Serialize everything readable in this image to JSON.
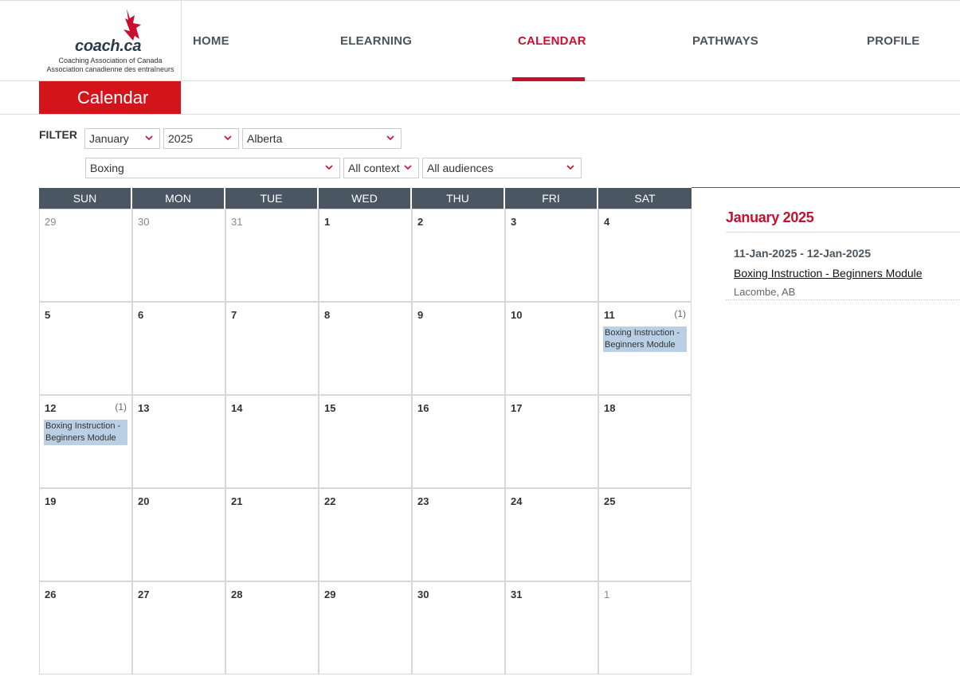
{
  "brand": {
    "logo_word": "coach.ca",
    "line1": "Coaching Association of Canada",
    "line2": "Association canadienne des entraîneurs",
    "accent": "#c8102e"
  },
  "nav": {
    "items": [
      {
        "label": "HOME"
      },
      {
        "label": "ELEARNING"
      },
      {
        "label": "CALENDAR",
        "active": true
      },
      {
        "label": "PATHWAYS"
      },
      {
        "label": "PROFILE"
      }
    ]
  },
  "page": {
    "title": "Calendar"
  },
  "filter": {
    "label": "FILTER",
    "month": "January",
    "year": "2025",
    "province": "Alberta",
    "sport": "Boxing",
    "context": "All context",
    "audience": "All audiences"
  },
  "calendar": {
    "weekdays": [
      "SUN",
      "MON",
      "TUE",
      "WED",
      "THU",
      "FRI",
      "SAT"
    ],
    "weeks": [
      [
        {
          "d": "29",
          "m": true
        },
        {
          "d": "30",
          "m": true
        },
        {
          "d": "31",
          "m": true
        },
        {
          "d": "1"
        },
        {
          "d": "2"
        },
        {
          "d": "3"
        },
        {
          "d": "4"
        }
      ],
      [
        {
          "d": "5"
        },
        {
          "d": "6"
        },
        {
          "d": "7"
        },
        {
          "d": "8"
        },
        {
          "d": "9"
        },
        {
          "d": "10"
        },
        {
          "d": "11",
          "count": "(1)",
          "event": "Boxing Instruction - Beginners Module"
        }
      ],
      [
        {
          "d": "12",
          "count": "(1)",
          "event": "Boxing Instruction - Beginners Module"
        },
        {
          "d": "13"
        },
        {
          "d": "14"
        },
        {
          "d": "15"
        },
        {
          "d": "16"
        },
        {
          "d": "17"
        },
        {
          "d": "18"
        }
      ],
      [
        {
          "d": "19"
        },
        {
          "d": "20"
        },
        {
          "d": "21"
        },
        {
          "d": "22"
        },
        {
          "d": "23"
        },
        {
          "d": "24"
        },
        {
          "d": "25"
        }
      ],
      [
        {
          "d": "26"
        },
        {
          "d": "27"
        },
        {
          "d": "28"
        },
        {
          "d": "29"
        },
        {
          "d": "30"
        },
        {
          "d": "31"
        },
        {
          "d": "1",
          "m": true
        }
      ]
    ]
  },
  "side": {
    "month": "January 2025",
    "event": {
      "dates": "11-Jan-2025  -  12-Jan-2025",
      "title": "Boxing Instruction - Beginners Module",
      "location": "Lacombe, AB"
    }
  }
}
